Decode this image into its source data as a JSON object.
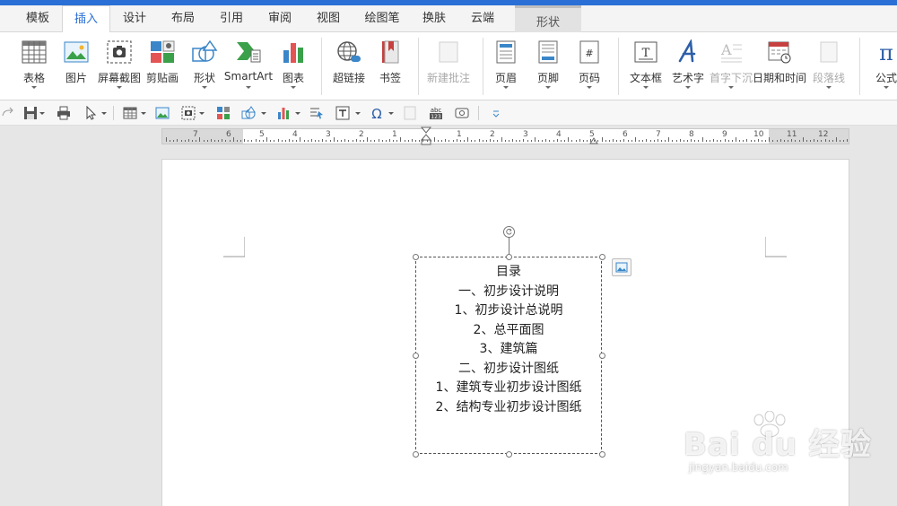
{
  "tabs": [
    "模板",
    "插入",
    "设计",
    "布局",
    "引用",
    "审阅",
    "视图",
    "绘图笔",
    "换肤",
    "云端"
  ],
  "active_tab": "插入",
  "context_tab": "形状",
  "ribbon": {
    "table": "表格",
    "picture": "图片",
    "screenshot": "屏幕截图",
    "clipart": "剪贴画",
    "shapes": "形状",
    "smartart": "SmartArt",
    "chart": "图表",
    "hyperlink": "超链接",
    "bookmark": "书签",
    "new_comment": "新建批注",
    "header": "页眉",
    "footer": "页脚",
    "page_number": "页码",
    "textbox": "文本框",
    "wordart": "艺术字",
    "dropcap": "首字下沉",
    "datetime": "日期和时间",
    "paragraph_line": "段落线",
    "formula": "公式"
  },
  "ruler_numbers": [
    "7",
    "6",
    "5",
    "4",
    "3",
    "2",
    "1",
    "1",
    "2",
    "3",
    "4",
    "5",
    "6",
    "7",
    "8",
    "9",
    "10",
    "11",
    "12"
  ],
  "document": {
    "toc_lines": [
      "目录",
      "一、初步设计说明",
      "1、初步设计总说明",
      "2、总平面图",
      "3、建筑篇",
      "二、初步设计图纸",
      "1、建筑专业初步设计图纸",
      "2、结构专业初步设计图纸"
    ]
  },
  "watermark": {
    "brand": "Bai du 经验",
    "url": "jingyan.baidu.com"
  },
  "colors": {
    "accent": "#2a6fd6",
    "ribbon_bg": "#ffffff",
    "workspace": "#e6e6e6"
  }
}
